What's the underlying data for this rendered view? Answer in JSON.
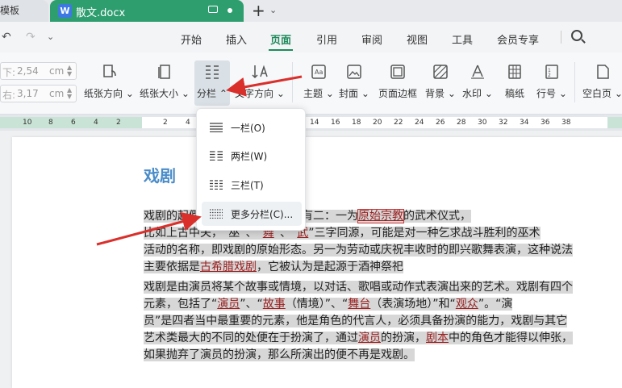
{
  "tabs": {
    "prev_label": "模板",
    "active_title": "散文.docx",
    "app_logo": "W"
  },
  "menu": {
    "items": [
      "开始",
      "插入",
      "页面",
      "引用",
      "审阅",
      "视图",
      "工具",
      "会员专享"
    ],
    "active": "页面"
  },
  "ribbon": {
    "margin_top": {
      "label": "下:",
      "value": "2,54",
      "unit": "cm"
    },
    "margin_left": {
      "label": "右:",
      "value": "3,17",
      "unit": "cm"
    },
    "buttons": {
      "orientation": "纸张方向",
      "size": "纸张大小",
      "columns": "分栏",
      "text_direction": "文字方向",
      "theme": "主题",
      "cover": "封面",
      "border": "页面边框",
      "background": "背景",
      "watermark": "水印",
      "manuscript": "稿纸",
      "line_number": "行号",
      "blank_page": "空白页"
    }
  },
  "ruler": {
    "ticks": [
      "10",
      "8",
      "6",
      "4",
      "2",
      "2",
      "4",
      "6",
      "8",
      "10",
      "12",
      "14",
      "16",
      "18",
      "20",
      "22",
      "24",
      "26",
      "28",
      "30",
      "32",
      "34",
      "36",
      "38"
    ]
  },
  "dropdown": {
    "items": [
      "一栏(O)",
      "两栏(W)",
      "三栏(T)",
      "更多分栏(C)..."
    ]
  },
  "document": {
    "title": "戏剧",
    "p1": [
      {
        "t": "戏剧的起",
        "c": ""
      },
      {
        "t": "假说。比较主流的看法有二：一为",
        "c": ""
      },
      {
        "t": "原始宗教",
        "c": "lnk boxed"
      },
      {
        "t": "的武术仪式，",
        "c": ""
      }
    ],
    "p1_line2": [
      {
        "t": "比如上古中关，",
        "c": ""
      },
      {
        "t": "“巫”、“",
        "c": ""
      },
      {
        "t": "舞",
        "c": "lnk"
      },
      {
        "t": "”、“",
        "c": ""
      },
      {
        "t": "武",
        "c": "lnk"
      },
      {
        "t": "”三字同源，可能是对一种乞求战斗胜利的巫术",
        "c": ""
      }
    ],
    "p1_line3": "活动的名称，即戏剧的原始形态。另一为劳动或庆祝丰收时的即兴歌舞表演，这种说法",
    "p1_line4_a": "主要依据是",
    "p1_line4_link": "古希腊戏剧",
    "p1_line4_b": "，它被认为是起源于酒神祭祀",
    "p2_line1": "戏剧是由演员将某个故事或情境，以对话、歌唱或动作式表演出来的艺术。戏剧有四个",
    "p2_line2_a": "元素，包括了“",
    "p2_line2_l1": "演员",
    "p2_line2_b": "”、“",
    "p2_line2_l2": "故事",
    "p2_line2_c": "（情境）”、“",
    "p2_line2_l3": "舞台",
    "p2_line2_d": "（表演场地）”和“",
    "p2_line2_l4": "观众",
    "p2_line2_e": "”。“演",
    "p2_line3": "员”是四者当中最重要的元素，他是角色的代言人，必须具备扮演的能力，戏剧与其它",
    "p2_line4_a": "艺术类最大的不同的处便在于扮演了，通过",
    "p2_line4_l1": "演员",
    "p2_line4_b": "的扮演，",
    "p2_line4_l2": "剧本",
    "p2_line4_c": "中的角色才能得以伸张，",
    "p2_line5": "如果抛弃了演员的扮演，那么所演出的便不再是戏剧。"
  },
  "colors": {
    "accent": "#2e9e6f",
    "link": "#9b2020",
    "title": "#4a8cc9",
    "arrow": "#d9302c"
  }
}
